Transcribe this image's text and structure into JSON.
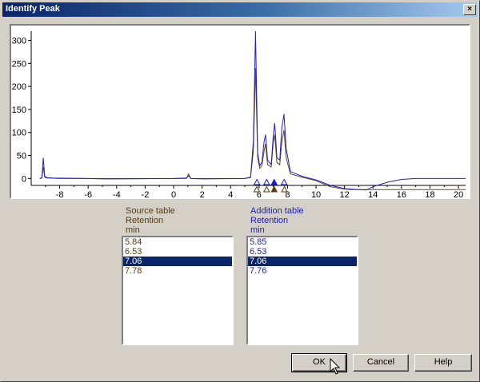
{
  "window": {
    "title": "Identify Peak",
    "close_glyph": "×"
  },
  "chart_data": {
    "type": "line",
    "xlim": [
      -10,
      20.5
    ],
    "ylim": [
      -15,
      320
    ],
    "x_ticks": [
      "-8",
      "-6",
      "-4",
      "-2",
      "0",
      "2",
      "4",
      "6",
      "8",
      "10",
      "12",
      "14",
      "16",
      "18",
      "20"
    ],
    "y_ticks": [
      "0",
      "50",
      "100",
      "150",
      "200",
      "250",
      "300"
    ],
    "series": [
      {
        "color": "#2020cc",
        "points": [
          [
            -9.4,
            0
          ],
          [
            -9.25,
            2
          ],
          [
            -9.15,
            45
          ],
          [
            -9.05,
            5
          ],
          [
            -8.9,
            2
          ],
          [
            -8.5,
            1
          ],
          [
            -6,
            0
          ],
          [
            -5,
            -1
          ],
          [
            -4,
            -1
          ],
          [
            0,
            0
          ],
          [
            0.9,
            1
          ],
          [
            1.05,
            6
          ],
          [
            1.2,
            0
          ],
          [
            2,
            -1
          ],
          [
            5,
            0
          ],
          [
            5.4,
            3
          ],
          [
            5.6,
            80
          ],
          [
            5.75,
            320
          ],
          [
            5.9,
            55
          ],
          [
            6.05,
            28
          ],
          [
            6.2,
            35
          ],
          [
            6.35,
            80
          ],
          [
            6.45,
            95
          ],
          [
            6.6,
            40
          ],
          [
            6.85,
            30
          ],
          [
            7.0,
            95
          ],
          [
            7.1,
            120
          ],
          [
            7.25,
            45
          ],
          [
            7.45,
            40
          ],
          [
            7.6,
            110
          ],
          [
            7.75,
            140
          ],
          [
            7.9,
            65
          ],
          [
            8.2,
            15
          ],
          [
            9,
            5
          ],
          [
            10,
            -3
          ],
          [
            11,
            -15
          ],
          [
            12,
            -22
          ],
          [
            13,
            -24
          ],
          [
            13.5,
            -25
          ],
          [
            14,
            -18
          ],
          [
            15,
            -8
          ],
          [
            16,
            -2
          ],
          [
            17,
            0
          ],
          [
            20.5,
            0
          ]
        ]
      },
      {
        "color": "#6b4a1a",
        "points": [
          [
            -9.4,
            0
          ],
          [
            -9.25,
            1
          ],
          [
            -9.15,
            25
          ],
          [
            -9.05,
            3
          ],
          [
            -8.9,
            1
          ],
          [
            -8,
            0
          ],
          [
            0,
            0
          ],
          [
            0.9,
            0
          ],
          [
            1.05,
            10
          ],
          [
            1.2,
            0
          ],
          [
            5,
            0
          ],
          [
            5.4,
            2
          ],
          [
            5.6,
            60
          ],
          [
            5.75,
            240
          ],
          [
            5.9,
            45
          ],
          [
            6.05,
            22
          ],
          [
            6.2,
            28
          ],
          [
            6.35,
            60
          ],
          [
            6.45,
            75
          ],
          [
            6.6,
            30
          ],
          [
            6.85,
            25
          ],
          [
            7.0,
            80
          ],
          [
            7.1,
            95
          ],
          [
            7.25,
            35
          ],
          [
            7.45,
            30
          ],
          [
            7.6,
            80
          ],
          [
            7.75,
            105
          ],
          [
            7.9,
            45
          ],
          [
            8.2,
            10
          ],
          [
            9,
            3
          ],
          [
            10,
            -5
          ],
          [
            11,
            -18
          ],
          [
            12,
            -23
          ],
          [
            12.5,
            -24
          ],
          [
            20.5,
            -24
          ]
        ]
      }
    ],
    "peak_markers": {
      "addition": [
        {
          "x": 5.85,
          "filled": false
        },
        {
          "x": 6.53,
          "filled": false
        },
        {
          "x": 7.06,
          "filled": true
        },
        {
          "x": 7.76,
          "filled": false
        }
      ],
      "source": [
        {
          "x": 5.84,
          "filled": false
        },
        {
          "x": 6.53,
          "filled": false
        },
        {
          "x": 7.06,
          "filled": true
        },
        {
          "x": 7.78,
          "filled": false
        }
      ]
    }
  },
  "source": {
    "label_line1": "Source table",
    "label_line2": "Retention",
    "label_line3": "min",
    "items": [
      "5.84",
      "6.53",
      "7.06",
      "7.78"
    ],
    "selected_index": 2
  },
  "addition": {
    "label_line1": "Addition table",
    "label_line2": "Retention",
    "label_line3": "min",
    "items": [
      "5.85",
      "6.53",
      "7.06",
      "7.76"
    ],
    "selected_index": 2
  },
  "buttons": {
    "ok": "OK",
    "cancel": "Cancel",
    "help": "Help"
  },
  "colors": {
    "source": "#5a3a0a",
    "addition": "#1a1acc",
    "selection": "#0a246a",
    "title_bar": "#0a246a"
  }
}
